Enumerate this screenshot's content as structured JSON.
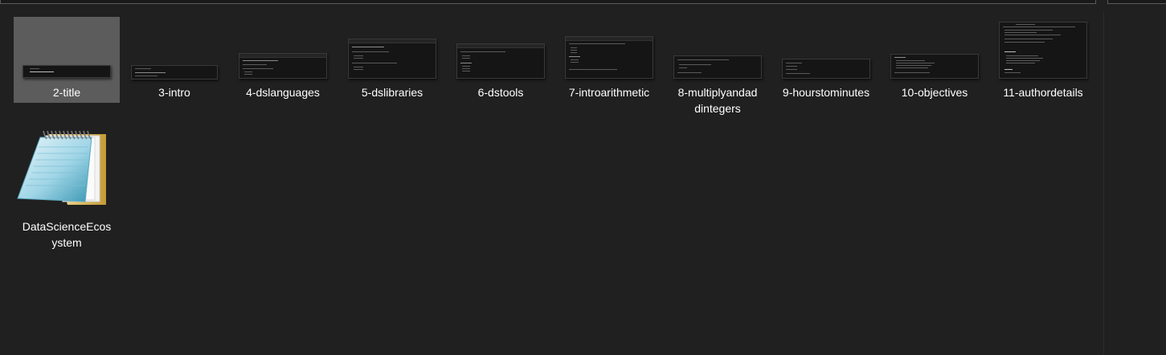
{
  "items": [
    {
      "label": "2-title",
      "selected": true
    },
    {
      "label": "3-intro",
      "selected": false
    },
    {
      "label": "4-dslanguages",
      "selected": false
    },
    {
      "label": "5-dslibraries",
      "selected": false
    },
    {
      "label": "6-dstools",
      "selected": false
    },
    {
      "label": "7-introarithmetic",
      "selected": false
    },
    {
      "label": "8-multiplyandad\ndintegers",
      "selected": false
    },
    {
      "label": "9-hourstominutes",
      "selected": false
    },
    {
      "label": "10-objectives",
      "selected": false
    },
    {
      "label": "11-authordetails",
      "selected": false
    }
  ],
  "notepad_file": {
    "label": "DataScienceEcos\nystem",
    "icon": "notepad-icon"
  },
  "colors": {
    "background": "#202020",
    "selection": "#5c5c5c",
    "text": "#ffffff"
  }
}
